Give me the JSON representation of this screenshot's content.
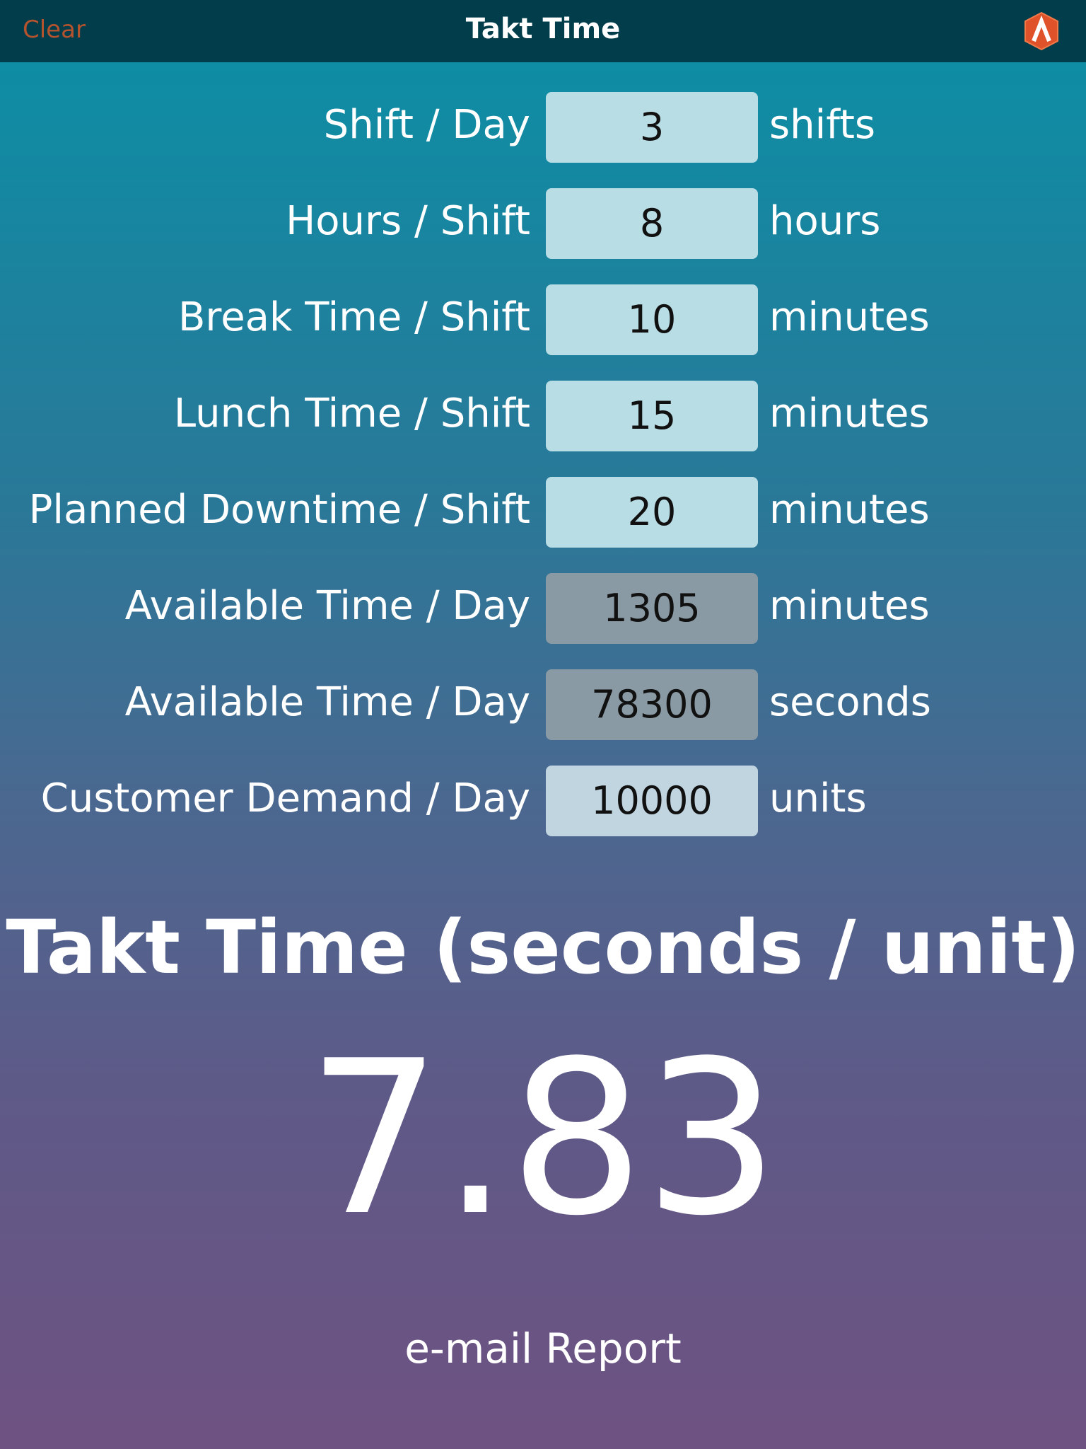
{
  "navbar": {
    "clear_label": "Clear",
    "title": "Takt Time",
    "logo_icon": "app-logo-icon"
  },
  "rows": [
    {
      "label": "Shift / Day",
      "value": "3",
      "unit": "shifts",
      "editable": true
    },
    {
      "label": "Hours / Shift",
      "value": "8",
      "unit": "hours",
      "editable": true
    },
    {
      "label": "Break Time / Shift",
      "value": "10",
      "unit": "minutes",
      "editable": true
    },
    {
      "label": "Lunch Time / Shift",
      "value": "15",
      "unit": "minutes",
      "editable": true
    },
    {
      "label": "Planned Downtime / Shift",
      "value": "20",
      "unit": "minutes",
      "editable": true
    },
    {
      "label": "Available Time / Day",
      "value": "1305",
      "unit": "minutes",
      "editable": false
    },
    {
      "label": "Available Time / Day",
      "value": "78300",
      "unit": "seconds",
      "editable": false
    },
    {
      "label": "Customer Demand / Day",
      "value": "10000",
      "unit": "units",
      "editable": true
    }
  ],
  "result": {
    "title": "Takt Time (seconds / unit)",
    "value": "7.83"
  },
  "email_label": "e-mail Report",
  "colors": {
    "navbar_bg": "#013d4b",
    "clear_text": "#b5532e",
    "input_bg": "#b9dde5",
    "calc_bg": "#8a9aa5",
    "logo_orange": "#e0522a"
  }
}
